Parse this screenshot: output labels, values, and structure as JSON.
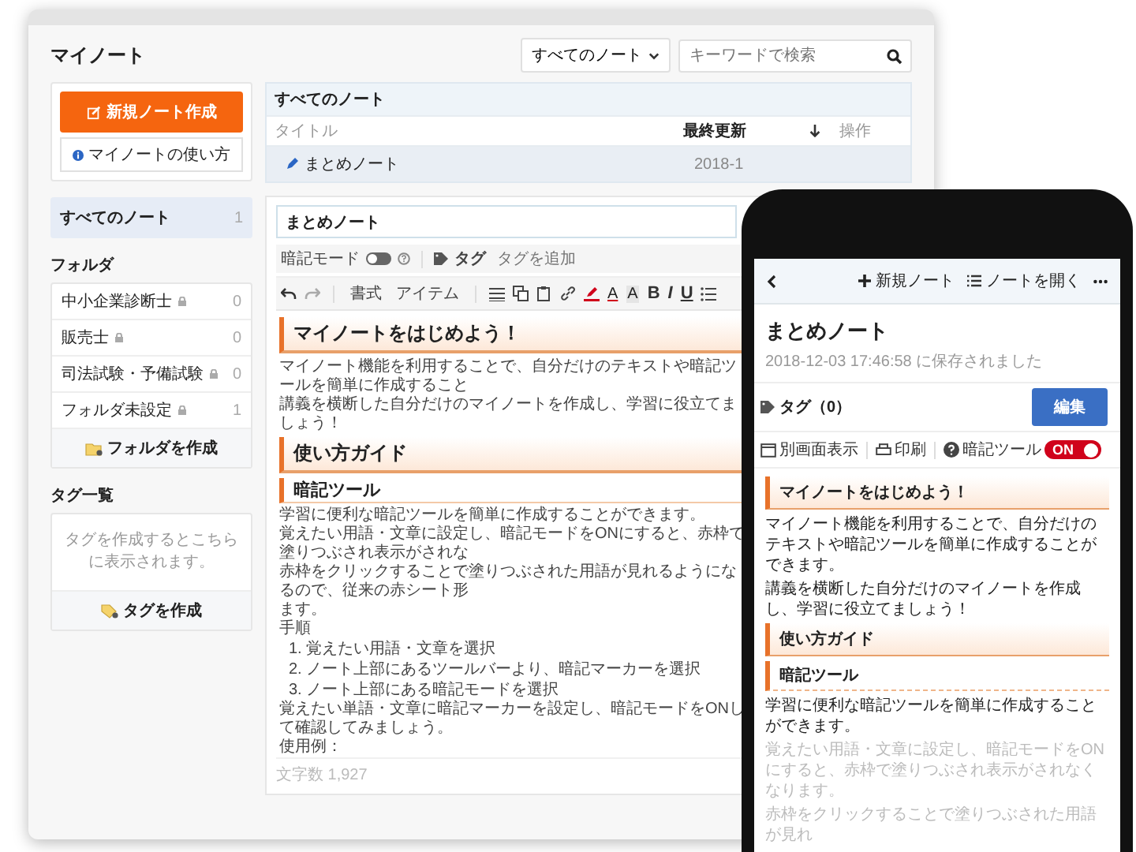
{
  "desktop": {
    "title": "マイノート",
    "filter": {
      "value": "すべてのノート"
    },
    "search": {
      "placeholder": "キーワードで検索"
    },
    "sidebar": {
      "new_button": "新規ノート作成",
      "help_button": "マイノートの使い方",
      "all_notes": {
        "label": "すべてのノート",
        "count": "1",
        "selected": true
      },
      "folders_heading": "フォルダ",
      "folders": [
        {
          "name": "中小企業診断士",
          "count": "0"
        },
        {
          "name": "販売士",
          "count": "0"
        },
        {
          "name": "司法試験・予備試験",
          "count": "0"
        },
        {
          "name": "フォルダ未設定",
          "count": "1"
        }
      ],
      "create_folder": "フォルダを作成",
      "tags_heading": "タグ一覧",
      "tags_empty": "タグを作成するとこちらに表示されます。",
      "create_tag": "タグを作成"
    },
    "note_list": {
      "title": "すべてのノート",
      "columns": [
        "タイトル",
        "最終更新",
        "操作"
      ],
      "rows": [
        {
          "title": "まとめノート",
          "updated": "2018-1",
          "selected": true
        }
      ]
    },
    "editor": {
      "title_value": "まとめノート",
      "memorize_mode": {
        "label": "暗記モード",
        "on": false
      },
      "tag_label": "タグ",
      "tag_placeholder": "タグを追加",
      "toolbar": {
        "format": "書式",
        "item": "アイテム",
        "color_buttons": [
          "A",
          "A"
        ],
        "style_buttons": [
          "B",
          "I",
          "U"
        ]
      },
      "content": [
        {
          "kind": "h1",
          "text": "マイノートをはじめよう！"
        },
        {
          "kind": "p",
          "text": "マイノート機能を利用することで、自分だけのテキストや暗記ツールを簡単に作成すること"
        },
        {
          "kind": "p",
          "text": "講義を横断した自分だけのマイノートを作成し、学習に役立てましょう！"
        },
        {
          "kind": "h1",
          "text": "使い方ガイド"
        },
        {
          "kind": "h2",
          "text": "暗記ツール"
        },
        {
          "kind": "p",
          "text": "学習に便利な暗記ツールを簡単に作成することができます。"
        },
        {
          "kind": "p",
          "text": "覚えたい用語・文章に設定し、暗記モードをONにすると、赤枠で塗りつぶされ表示がされな"
        },
        {
          "kind": "p",
          "text": "赤枠をクリックすることで塗りつぶされた用語が見れるようになるので、従来の赤シート形"
        },
        {
          "kind": "p",
          "text": "ます。"
        },
        {
          "kind": "p",
          "text": "手順"
        },
        {
          "kind": "ol",
          "items": [
            "1. 覚えたい用語・文章を選択",
            "2. ノート上部にあるツールバーより、暗記マーカーを選択",
            "3. ノート上部にある暗記モードを選択"
          ]
        },
        {
          "kind": "p",
          "text": "覚えたい単語・文章に暗記マーカーを設定し、暗記モードをONして確認してみましょう。"
        },
        {
          "kind": "p",
          "text": "使用例："
        }
      ],
      "char_count": "文字数 1,927"
    }
  },
  "phone": {
    "header": {
      "new_note": "新規ノート",
      "open_note": "ノートを開く"
    },
    "title": "まとめノート",
    "saved": "2018-12-03 17:46:58 に保存されました",
    "tags": "タグ（0）",
    "edit_button": "編集",
    "toolbar": {
      "separate": "別画面表示",
      "print": "印刷",
      "memorize": {
        "label": "暗記ツール",
        "on": true,
        "toggle_text": "ON"
      }
    },
    "content": [
      {
        "kind": "h1",
        "text": "マイノートをはじめよう！"
      },
      {
        "kind": "p",
        "text": "マイノート機能を利用することで、自分だけのテキストや暗記ツールを簡単に作成することができます。",
        "faded": false
      },
      {
        "kind": "p",
        "text": "講義を横断した自分だけのマイノートを作成し、学習に役立てましょう！",
        "faded": false
      },
      {
        "kind": "h1",
        "text": "使い方ガイド"
      },
      {
        "kind": "h2",
        "text": "暗記ツール"
      },
      {
        "kind": "p",
        "text": "学習に便利な暗記ツールを簡単に作成することができます。",
        "faded": false
      },
      {
        "kind": "p",
        "text": "覚えたい用語・文章に設定し、暗記モードをONにすると、赤枠で塗りつぶされ表示がされなくなります。",
        "faded": true
      },
      {
        "kind": "p",
        "text": "赤枠をクリックすることで塗りつぶされた用語が見れ",
        "faded": true
      }
    ]
  }
}
